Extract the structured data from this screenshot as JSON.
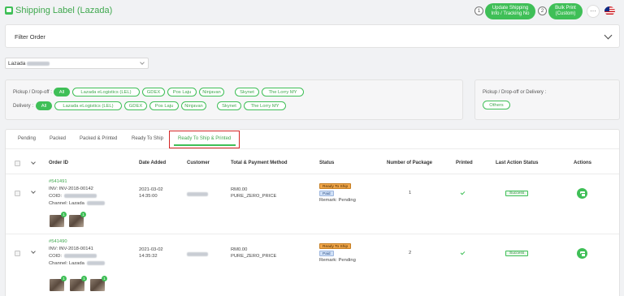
{
  "header": {
    "title": "Shipping Label (Lazada)",
    "step1": "1",
    "step2": "2",
    "update_button": "Update Shipping Info / Tracking No",
    "bulk_print_button": "Bulk Print (Custom)",
    "more_label": "···"
  },
  "filter": {
    "label": "Filter Order"
  },
  "store": {
    "name": "Lazada"
  },
  "couriers": {
    "pickup_label": "Pickup / Drop-off :",
    "delivery_label": "Delivery :",
    "pickup_chips": [
      "All",
      "Lazada eLogistics (LEL)",
      "GDEX",
      "Pos Laju",
      "Ninjavan",
      "Skynet",
      "The Lorry MY"
    ],
    "delivery_chips": [
      "All",
      "Lazada eLogistics (LEL)",
      "GDEX",
      "Pos Laju",
      "Ninjavan",
      "Skynet",
      "The Lorry MY"
    ],
    "others_label": "Pickup / Drop-off or Delivery :",
    "others_chip": "Others"
  },
  "tabs": [
    "Pending",
    "Packed",
    "Packed & Printed",
    "Ready To Ship",
    "Ready To Ship & Printed"
  ],
  "columns": [
    "Order ID",
    "Date Added",
    "Customer",
    "Total & Payment Method",
    "Status",
    "Number of Package",
    "Printed",
    "Last Action Status",
    "Actions"
  ],
  "orders": [
    {
      "order_id": "#541491",
      "inv": "INV: INV-2018-00142",
      "cod_label": "COID:",
      "channel_label": "Channel: Lazada",
      "date": "2021-03-02",
      "time": "14:35:00",
      "customer": "",
      "total": "RM0.00",
      "payment": "PURE_ZERO_PRICE",
      "status_badge": "Ready To Ship",
      "paid_badge": "Paid",
      "remark": "Remark: Pending",
      "packages": "1",
      "last_action": "Success",
      "thumb_counts": [
        "1",
        "1"
      ]
    },
    {
      "order_id": "#541490",
      "inv": "INV: INV-2018-00141",
      "cod_label": "COID:",
      "channel_label": "Channel: Lazada",
      "date": "2021-03-02",
      "time": "14:35:32",
      "customer": "",
      "total": "RM0.00",
      "payment": "PURE_ZERO_PRICE",
      "status_badge": "Ready To Ship",
      "paid_badge": "Paid",
      "remark": "Remark: Pending",
      "packages": "2",
      "last_action": "Success",
      "thumb_counts": [
        "1",
        "1",
        "1"
      ]
    }
  ],
  "colors": {
    "accent": "#3fbf57",
    "highlight_box": "#d32525",
    "ready_badge": "#f0a64a",
    "paid_badge": "#cfe0f7"
  }
}
